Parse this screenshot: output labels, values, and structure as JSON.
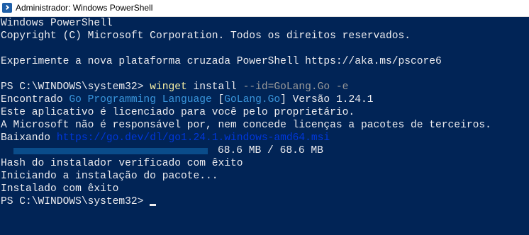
{
  "window": {
    "title": "Administrador: Windows PowerShell",
    "icon": "powershell-icon"
  },
  "console": {
    "banner_line1": "Windows PowerShell",
    "banner_line2": "Copyright (C) Microsoft Corporation. Todos os direitos reservados.",
    "banner_line3": "Experimente a nova plataforma cruzada PowerShell https://aka.ms/pscore6",
    "prompt": "PS C:\\WINDOWS\\system32> ",
    "command": {
      "exe": "winget",
      "arg": " install ",
      "param": "--id=GoLang.Go -e"
    },
    "found": {
      "prefix": "Encontrado ",
      "name": "Go Programming Language",
      "id_open": " [",
      "id": "GoLang.Go",
      "id_close": "] Versão 1.24.1"
    },
    "license_line": "Este aplicativo é licenciado para você pelo proprietário.",
    "ms_line": "A Microsoft não é responsável por, nem concede licenças a pacotes de terceiros.",
    "download": {
      "label": "Baixando ",
      "url": "https://go.dev/dl/go1.24.1.windows-amd64.msi",
      "progress": 1.0,
      "progress_text": "68.6 MB / 68.6 MB"
    },
    "hash_line": "Hash do instalador verificado com êxito",
    "install_start_line": "Iniciando a instalação do pacote...",
    "installed_line": "Instalado com êxito",
    "final_prompt": "PS C:\\WINDOWS\\system32> "
  },
  "colors": {
    "background": "#012456",
    "foreground": "#eeedf0",
    "command": "#f9f1a5",
    "parameter": "#9a9a9a",
    "highlight": "#3a96dd",
    "link": "#0037da"
  }
}
